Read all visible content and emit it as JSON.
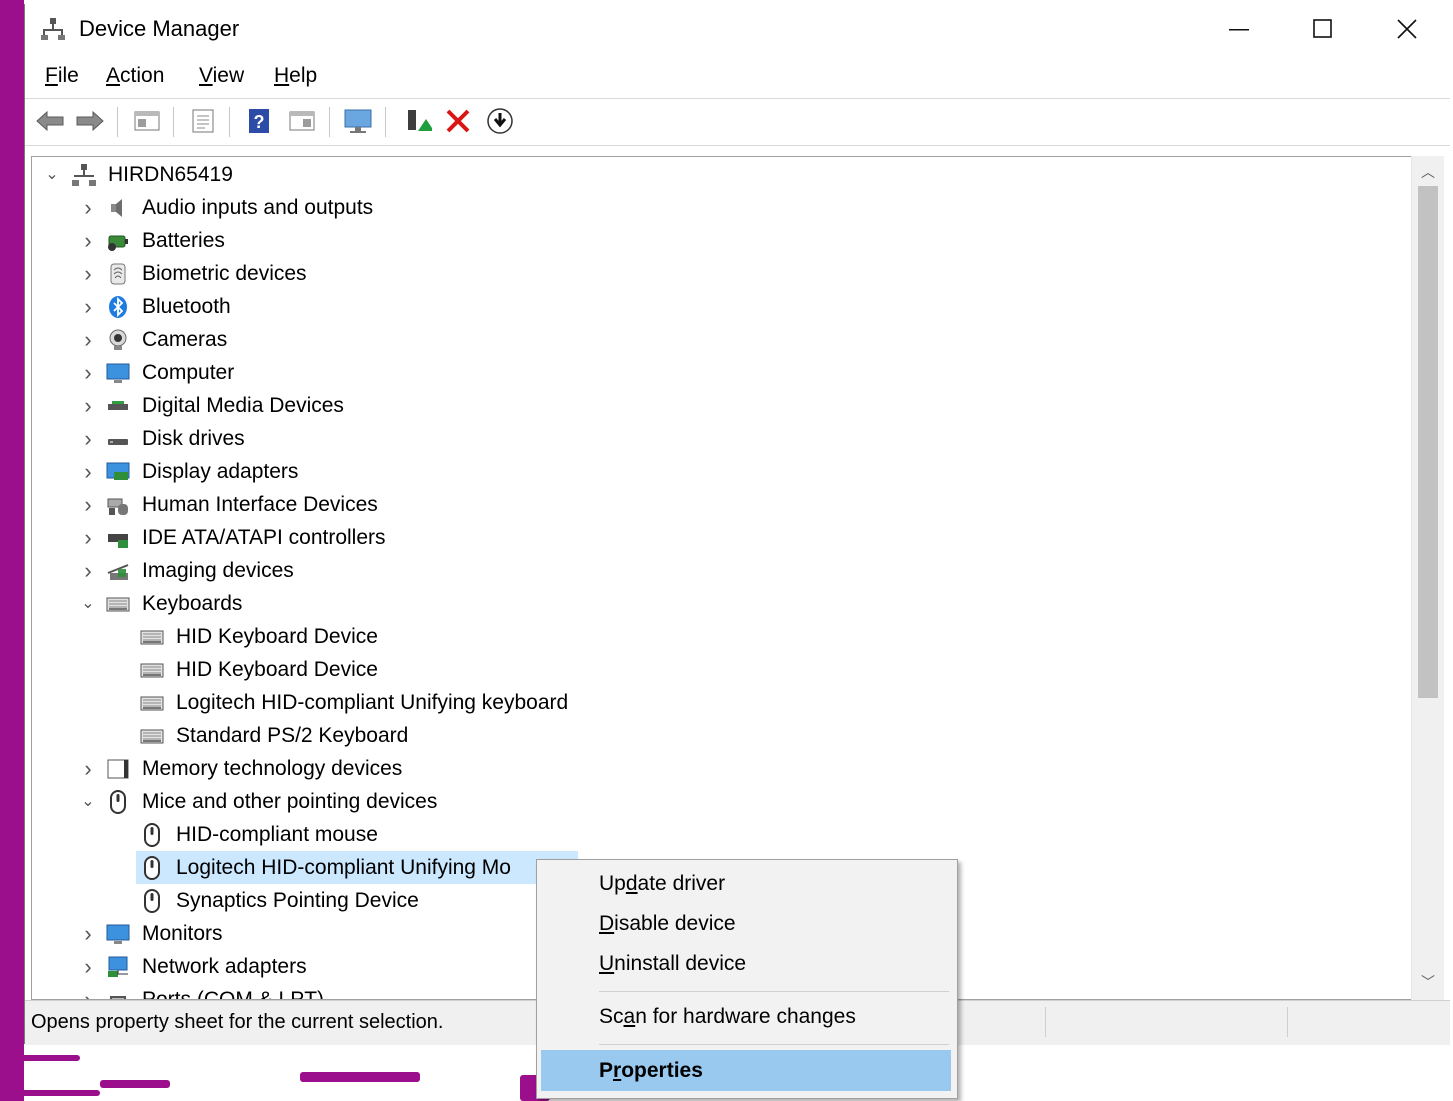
{
  "window": {
    "title": "Device Manager",
    "controls": {
      "minimize": "—",
      "maximize": "☐",
      "close": "✕"
    }
  },
  "menu": [
    {
      "mnemonic": "F",
      "rest": "ile"
    },
    {
      "mnemonic": "A",
      "rest": "ction"
    },
    {
      "mnemonic": "V",
      "rest": "iew"
    },
    {
      "mnemonic": "H",
      "rest": "elp"
    }
  ],
  "toolbar": {
    "icons": [
      "back-arrow-icon",
      "forward-arrow-icon",
      "show-hide-console-tree-icon",
      "properties-icon",
      "help-icon",
      "action-pane-icon",
      "monitor-icon",
      "update-driver-icon",
      "uninstall-icon",
      "install-download-icon"
    ]
  },
  "tree": {
    "root": "HIRDN65419",
    "items": [
      {
        "label": "Audio inputs and outputs",
        "icon": "speaker-icon"
      },
      {
        "label": "Batteries",
        "icon": "battery-icon"
      },
      {
        "label": "Biometric devices",
        "icon": "fingerprint-icon"
      },
      {
        "label": "Bluetooth",
        "icon": "bluetooth-icon"
      },
      {
        "label": "Cameras",
        "icon": "camera-icon"
      },
      {
        "label": "Computer",
        "icon": "computer-icon"
      },
      {
        "label": "Digital Media Devices",
        "icon": "media-device-icon"
      },
      {
        "label": "Disk drives",
        "icon": "disk-icon"
      },
      {
        "label": "Display adapters",
        "icon": "display-adapter-icon"
      },
      {
        "label": "Human Interface Devices",
        "icon": "hid-icon"
      },
      {
        "label": "IDE ATA/ATAPI controllers",
        "icon": "ide-controller-icon"
      },
      {
        "label": "Imaging devices",
        "icon": "scanner-icon"
      },
      {
        "label": "Keyboards",
        "icon": "keyboard-icon",
        "expanded": true
      },
      {
        "label": "HID Keyboard Device",
        "icon": "keyboard-icon",
        "child": true
      },
      {
        "label": "HID Keyboard Device",
        "icon": "keyboard-icon",
        "child": true
      },
      {
        "label": "Logitech HID-compliant Unifying keyboard",
        "icon": "keyboard-icon",
        "child": true
      },
      {
        "label": "Standard PS/2 Keyboard",
        "icon": "keyboard-icon",
        "child": true
      },
      {
        "label": "Memory technology devices",
        "icon": "memory-icon"
      },
      {
        "label": "Mice and other pointing devices",
        "icon": "mouse-icon",
        "expanded": true
      },
      {
        "label": "HID-compliant mouse",
        "icon": "mouse-icon",
        "child": true
      },
      {
        "label": "Logitech HID-compliant Unifying Mo",
        "icon": "mouse-icon",
        "child": true,
        "selected": true
      },
      {
        "label": "Synaptics Pointing Device",
        "icon": "mouse-icon",
        "child": true
      },
      {
        "label": "Monitors",
        "icon": "monitor-icon"
      },
      {
        "label": "Network adapters",
        "icon": "network-icon"
      },
      {
        "label": "Ports (COM & LPT)",
        "icon": "port-icon"
      }
    ]
  },
  "status": {
    "text": "Opens property sheet for the current selection."
  },
  "context_menu": {
    "items": [
      {
        "pre": "Up",
        "mn": "d",
        "post": "ate driver"
      },
      {
        "pre": "",
        "mn": "D",
        "post": "isable device"
      },
      {
        "pre": "",
        "mn": "U",
        "post": "ninstall device"
      },
      {
        "pre": "Sc",
        "mn": "a",
        "post": "n for hardware changes"
      },
      {
        "pre": "P",
        "mn": "r",
        "post": "operties",
        "bold": true,
        "highlighted": true
      }
    ]
  }
}
